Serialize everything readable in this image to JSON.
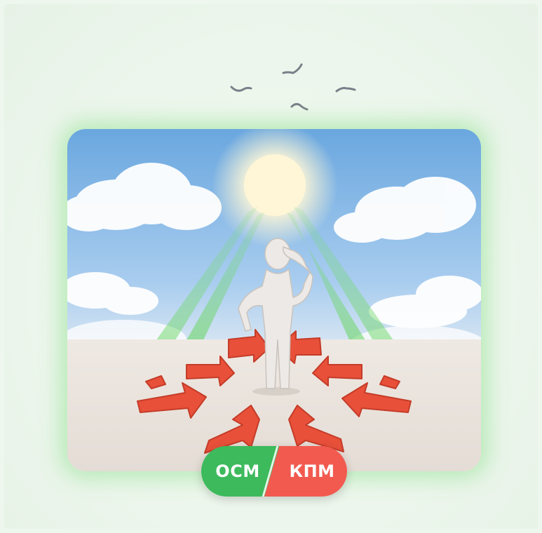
{
  "badge": {
    "left_label": "ОСМ",
    "right_label": "КПМ",
    "left_color": "#3dba5c",
    "right_color": "#f25a50"
  },
  "scene": {
    "sky_color": "#7fb3e3",
    "sun_color": "#fff6d8",
    "beam_color": "#6fd86a",
    "arrow_color": "#e8503a"
  }
}
